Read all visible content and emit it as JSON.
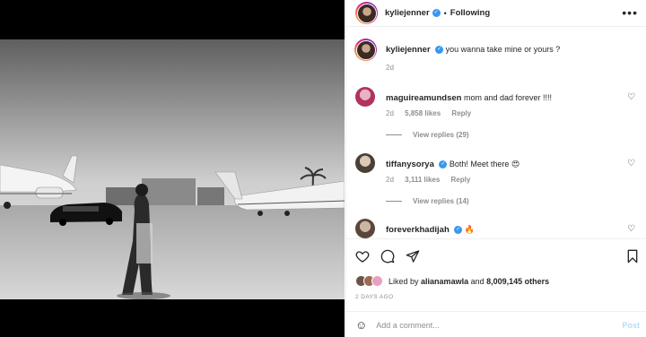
{
  "header": {
    "username": "kyliejenner",
    "separator": "•",
    "follow_label": "Following",
    "more_label": "•••"
  },
  "caption": {
    "username": "kyliejenner",
    "text": "you wanna take mine or yours ?",
    "age": "2d"
  },
  "comments": [
    {
      "username": "maguireamundsen",
      "text": "mom and dad forever !!!!",
      "age": "2d",
      "likes": "5,858 likes",
      "reply_label": "Reply",
      "view_replies": "View replies (29)"
    },
    {
      "username": "tiffanysorya",
      "text": "Both! Meet there 😍",
      "age": "2d",
      "likes": "3,111 likes",
      "reply_label": "Reply",
      "view_replies": "View replies (14)"
    },
    {
      "username": "foreverkhadijah",
      "text": "🔥"
    }
  ],
  "likes": {
    "prefix": "Liked by",
    "user": "alianamawla",
    "middle": "and",
    "others": "8,009,145 others"
  },
  "date_label": "2 DAYS AGO",
  "composer": {
    "placeholder": "Add a comment...",
    "post_label": "Post"
  },
  "icons": {
    "like": "heart-icon",
    "comment": "comment-icon",
    "share": "share-icon",
    "save": "bookmark-icon",
    "emoji": "emoji-icon",
    "verified": "verified-badge-icon"
  },
  "colors": {
    "verified": "#3897f0",
    "post_disabled": "#b2dffc",
    "muted": "#8e8e8e"
  }
}
